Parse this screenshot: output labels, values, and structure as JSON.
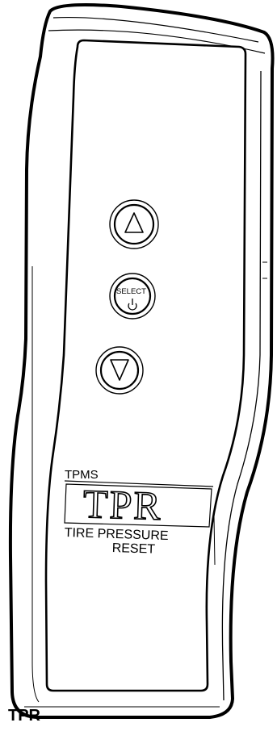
{
  "device": {
    "buttons": {
      "up_icon": "triangle-up-icon",
      "select_label": "SELECT",
      "select_icon": "power-icon",
      "down_icon": "triangle-down-icon"
    },
    "badge": {
      "top_label": "TPMS",
      "logo": "TPR",
      "line1": "TIRE PRESSURE",
      "line2": "RESET"
    }
  },
  "caption": "TPR"
}
